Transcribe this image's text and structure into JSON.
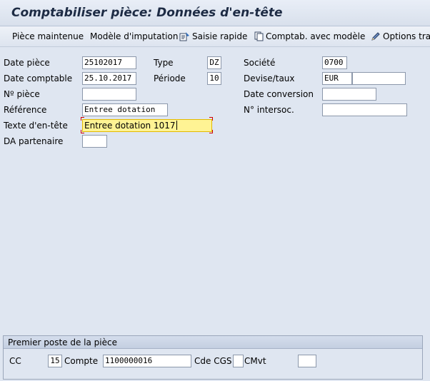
{
  "window": {
    "title": "Comptabiliser pièce: Données d'en-tête"
  },
  "toolbar": {
    "items": [
      {
        "label": "Pièce maintenue"
      },
      {
        "label": "Modèle d'imputation"
      },
      {
        "label": "Saisie rapide",
        "icon": "quick-entry-icon"
      },
      {
        "label": "Comptab. avec modèle",
        "icon": "document-copy-icon"
      },
      {
        "label": "Options trait",
        "icon": "pencil-icon"
      }
    ]
  },
  "header": {
    "doc_date": {
      "label": "Date pièce",
      "value": "25102017"
    },
    "posting_date": {
      "label": "Date comptable",
      "value": "25.10.2017"
    },
    "doc_number": {
      "label": "Nº pièce",
      "value": ""
    },
    "reference": {
      "label": "Référence",
      "value": "Entree dotation"
    },
    "header_text": {
      "label": "Texte d'en-tête",
      "value": "Entree dotation 1017"
    },
    "trading_partner": {
      "label": "DA partenaire",
      "value": ""
    },
    "type": {
      "label": "Type",
      "value": "DZ"
    },
    "period": {
      "label": "Période",
      "value": "10"
    },
    "company": {
      "label": "Société",
      "value": "0700"
    },
    "currency": {
      "label": "Devise/taux",
      "value": "EUR",
      "rate": ""
    },
    "translation_date": {
      "label": "Date conversion",
      "value": ""
    },
    "intercompany": {
      "label": "N° intersoc.",
      "value": ""
    }
  },
  "first_item": {
    "title": "Premier poste de la pièce",
    "posting_key": {
      "label": "CC",
      "value": "15"
    },
    "account": {
      "label": "Compte",
      "value": "1100000016"
    },
    "sgl_indicator": {
      "label": "Cde CGS",
      "value": ""
    },
    "transaction_type": {
      "label": "CMvt",
      "value": ""
    }
  },
  "colors": {
    "background": "#dfe6f1",
    "active_field": "#fff394",
    "title_text": "#1d2b44"
  }
}
